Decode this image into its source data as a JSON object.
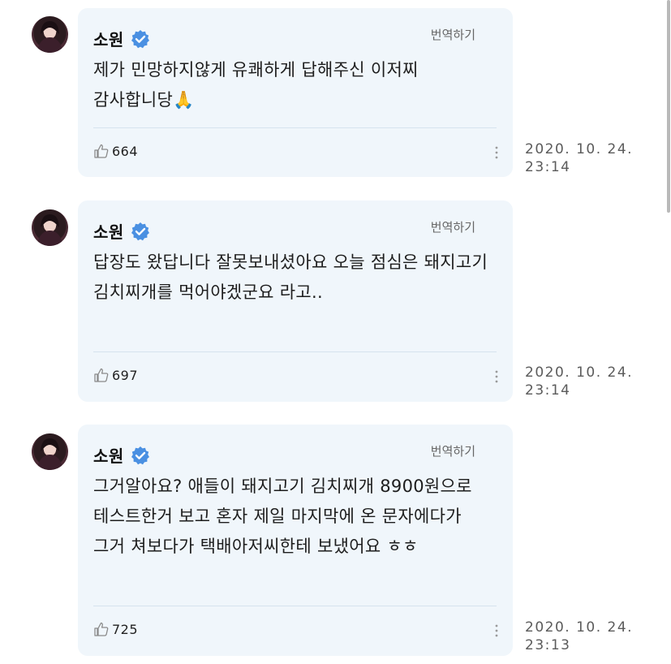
{
  "comments": [
    {
      "author": "소원",
      "translate_label": "번역하기",
      "text": "제가 민망하지않게 유쾌하게 답해주신 이저찌 감사합니당🙏",
      "likes": "664",
      "date": "2020. 10. 24.",
      "time": "23:14"
    },
    {
      "author": "소원",
      "translate_label": "번역하기",
      "text": "답장도 왔답니다 잘못보내셨아요 오늘 점심은 돼지고기 김치찌개를 먹어야겠군요 라고..",
      "likes": "697",
      "date": "2020. 10. 24.",
      "time": "23:14"
    },
    {
      "author": "소원",
      "translate_label": "번역하기",
      "text": "그거알아요? 애들이 돼지고기 김치찌개 8900원으로 테스트한거 보고 혼자 제일 마지막에 온 문자에다가 그거 쳐보다가 택배아저씨한테 보냈어요 ㅎㅎ",
      "likes": "725",
      "date": "2020. 10. 24.",
      "time": "23:13"
    }
  ],
  "colors": {
    "bubble_bg": "#f0f6fb",
    "verified_blue": "#4a90e2",
    "timestamp": "#5b5b5b"
  },
  "icons": {
    "verified": "verified-badge-icon",
    "like": "thumbs-up-icon",
    "more": "more-vertical-icon"
  }
}
